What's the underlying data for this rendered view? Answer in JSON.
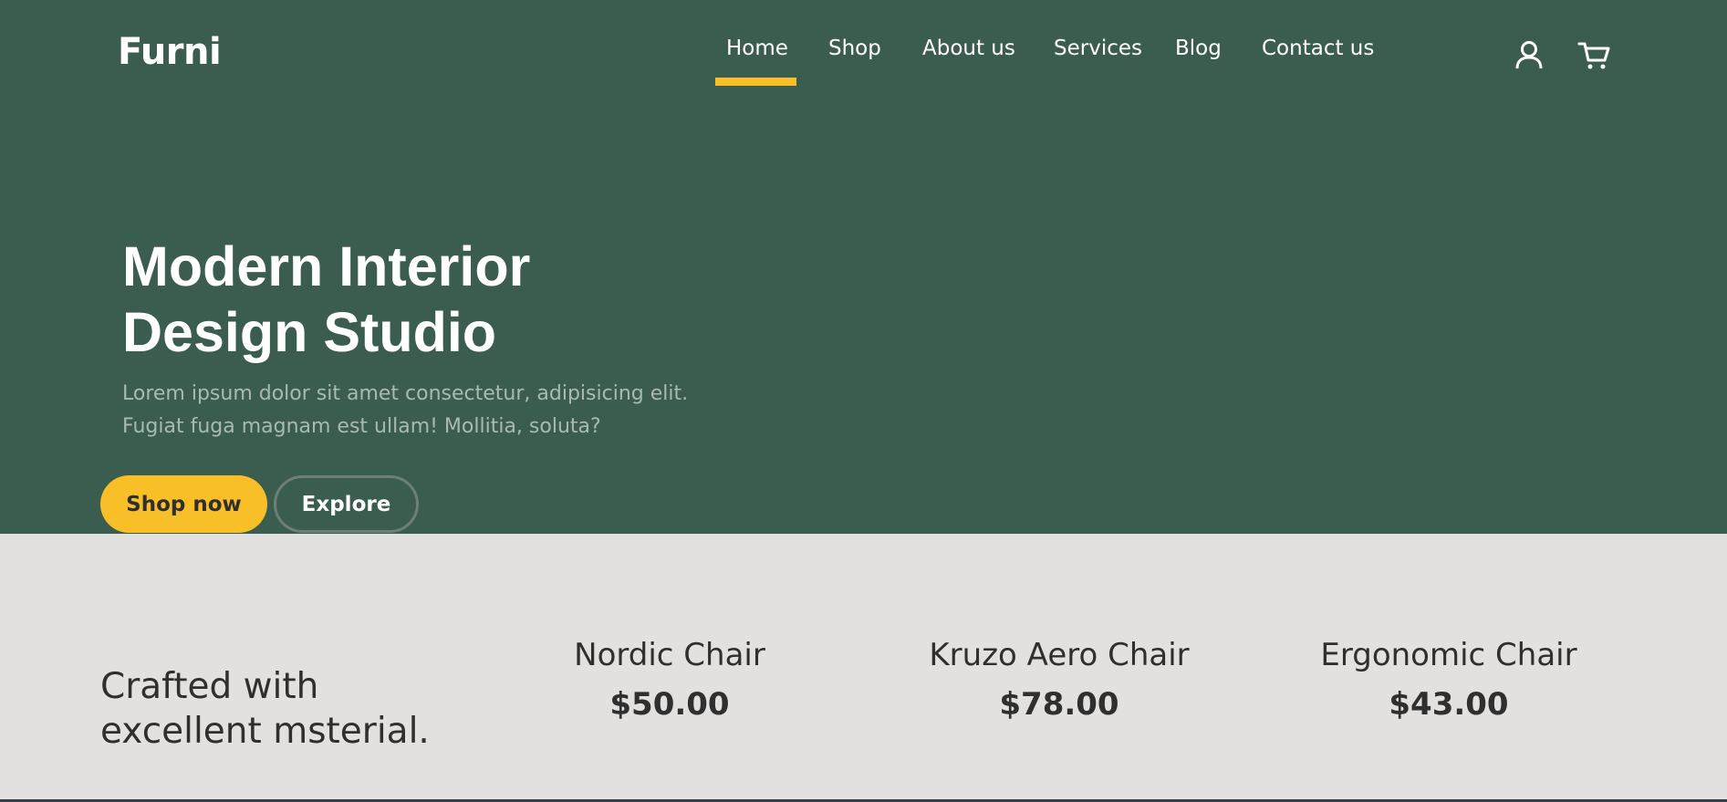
{
  "brand": {
    "name": "Furni"
  },
  "nav": {
    "items": [
      {
        "label": "Home",
        "active": true
      },
      {
        "label": "Shop"
      },
      {
        "label": "About us"
      },
      {
        "label": "Services"
      },
      {
        "label": "Blog"
      },
      {
        "label": "Contact us"
      }
    ],
    "icons": [
      "user-icon",
      "cart-icon"
    ]
  },
  "hero": {
    "title_line1": "Modern Interior",
    "title_line2": "Design Studio",
    "desc_line1": "Lorem ipsum dolor sit amet consectetur, adipisicing elit.",
    "desc_line2": "Fugiat fuga magnam est ullam! Mollitia, soluta?",
    "shop_label": "Shop now",
    "explore_label": "Explore"
  },
  "products": {
    "craft_line1": "Crafted with",
    "craft_line2": "excellent msterial.",
    "items": [
      {
        "name": "Nordic Chair",
        "price": "$50.00"
      },
      {
        "name": "Kruzo Aero Chair",
        "price": "$78.00"
      },
      {
        "name": "Ergonomic Chair",
        "price": "$43.00"
      }
    ]
  },
  "colors": {
    "hero_bg": "#3b5d50",
    "accent": "#f9bf29",
    "section_bg": "#e2e1df",
    "text_dark": "#2f2f2f"
  }
}
